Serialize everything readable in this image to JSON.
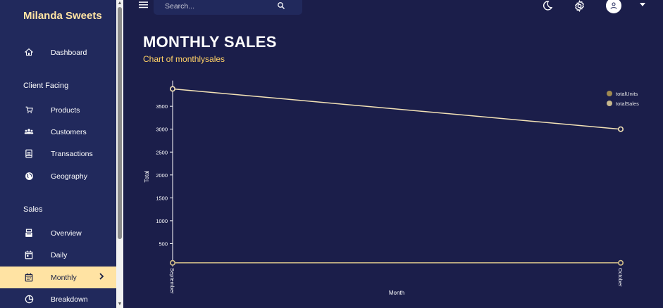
{
  "sidebar": {
    "brand": "Milanda Sweets",
    "items": [
      {
        "label": "Dashboard"
      },
      {
        "label": "Client Facing"
      },
      {
        "label": "Products"
      },
      {
        "label": "Customers"
      },
      {
        "label": "Transactions"
      },
      {
        "label": "Geography"
      },
      {
        "label": "Sales"
      },
      {
        "label": "Overview"
      },
      {
        "label": "Daily"
      },
      {
        "label": "Monthly"
      },
      {
        "label": "Breakdown"
      }
    ]
  },
  "topbar": {
    "search_placeholder": "Search..."
  },
  "header": {
    "title": "MONTHLY SALES",
    "subtitle": "Chart of monthlysales"
  },
  "colors": {
    "background": "#1b1e4a",
    "sidebar": "#21295c",
    "accent": "#ffe3a3",
    "subtitle": "#ffd166",
    "line_units": "#d4c08a",
    "line_sales": "#f3e2b6"
  },
  "chart_data": {
    "type": "line",
    "categories": [
      "September",
      "October"
    ],
    "series": [
      {
        "name": "totalUnits",
        "values": [
          80,
          80
        ],
        "color": "#a08a50"
      },
      {
        "name": "totalSales",
        "values": [
          3880,
          3000
        ],
        "color": "#c8b98e"
      }
    ],
    "xlabel": "Month",
    "ylabel": "Total",
    "ylim": [
      0,
      4000
    ],
    "yticks": [
      500,
      1000,
      1500,
      2000,
      2500,
      3000,
      3500
    ],
    "legend": "top-right"
  }
}
